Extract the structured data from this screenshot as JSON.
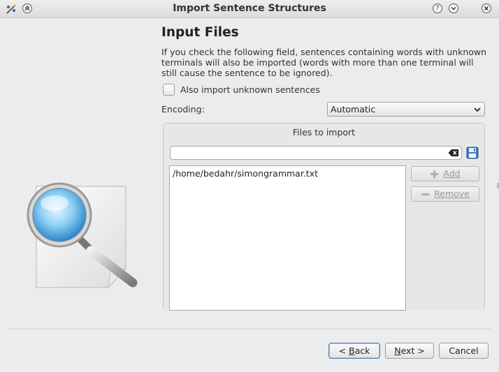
{
  "window": {
    "title": "Import Sentence Structures"
  },
  "page": {
    "heading": "Input Files",
    "description": "If you check the following field, sentences containing words with unknown terminals will also be imported (words with more than one terminal will still cause the sentence to be ignored).",
    "checkbox_label": "Also import unknown sentences",
    "checkbox_checked": false,
    "encoding_label": "Encoding:",
    "encoding_value": "Automatic"
  },
  "files_group": {
    "title": "Files to import",
    "path_value": "",
    "files": [
      "/home/bedahr/simongrammar.txt"
    ],
    "add_label": "Add",
    "remove_label": "Remove"
  },
  "footer": {
    "back_prefix": "< ",
    "back_key": "B",
    "back_rest": "ack",
    "next_key": "N",
    "next_rest": "ext >",
    "cancel_label": "Cancel"
  },
  "colors": {
    "accent": "#4e7bb8",
    "disabled_text": "#9a9a9a"
  }
}
